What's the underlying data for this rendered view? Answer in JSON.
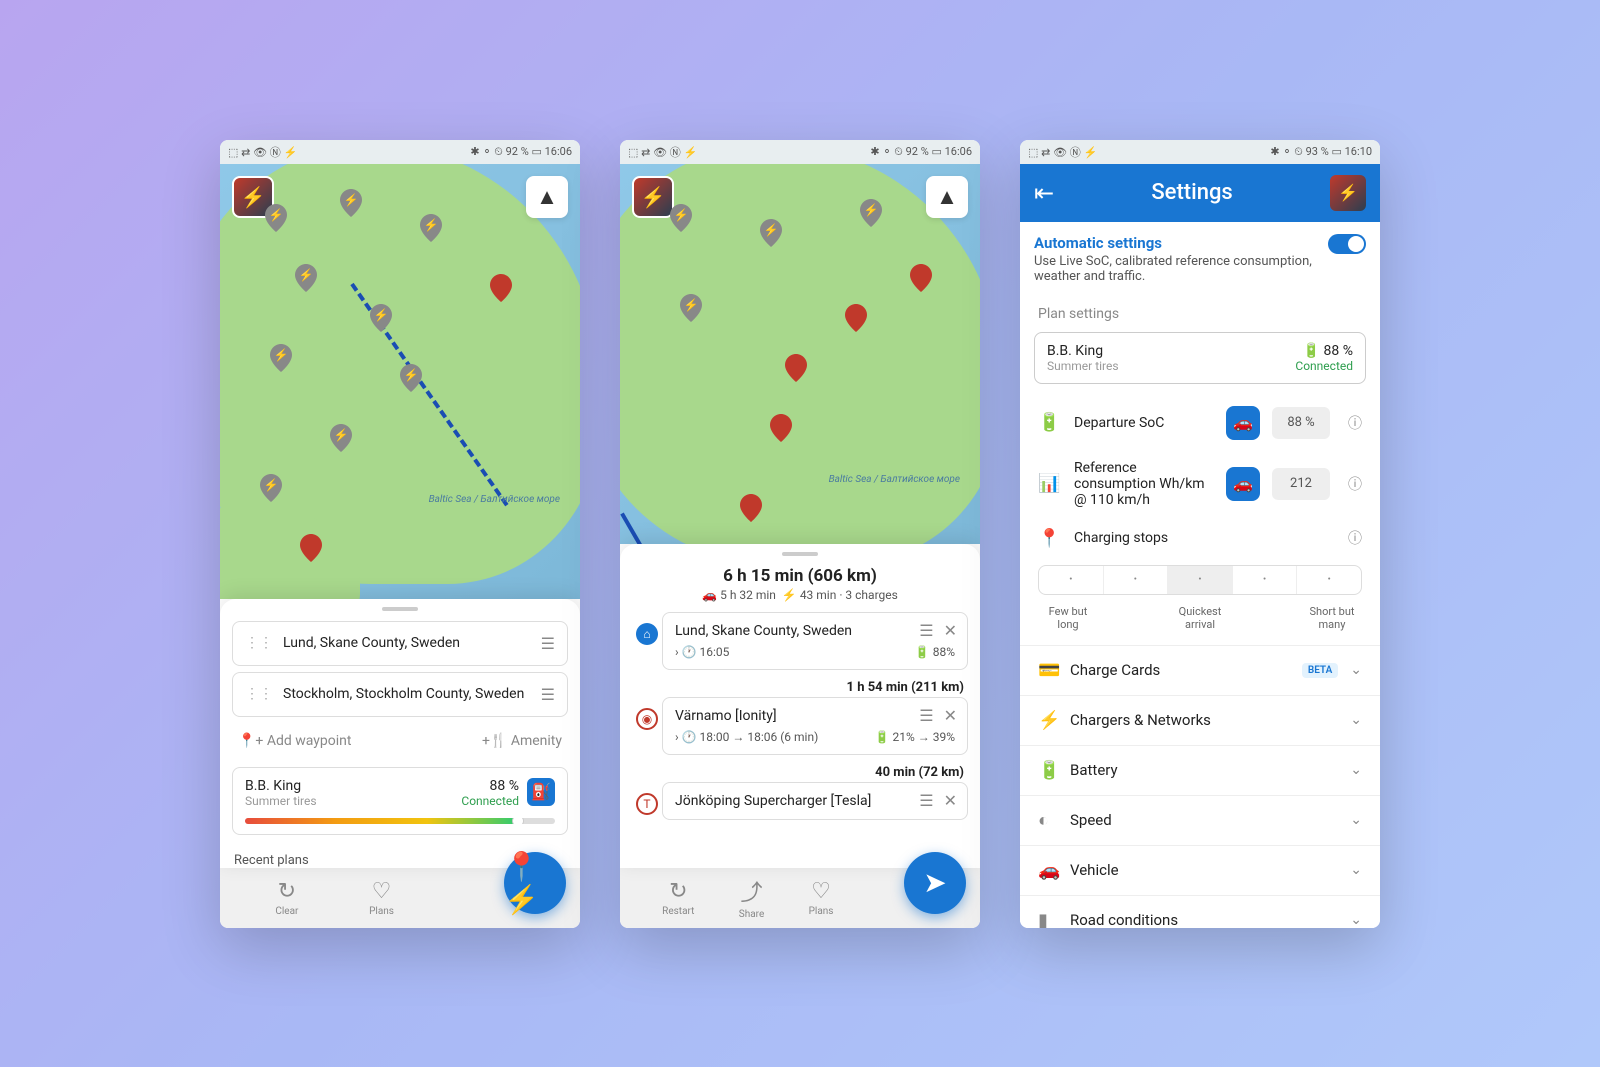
{
  "status_bar": {
    "left_icons": "⬚ ⇄ 👁 Ⓝ ⚡",
    "right1": "✱ ⚬ ⏲ 92 % ▭ 16:06",
    "right3": "✱ ⚬ ⏲ 93 % ▭ 16:10"
  },
  "screen1": {
    "sea_label": "Baltic Sea\n/ Балтийское\nморе",
    "origin": "Lund, Skane County, Sweden",
    "destination": "Stockholm, Stockholm County, Sweden",
    "add_waypoint": "Add waypoint",
    "amenity": "Amenity",
    "vehicle": {
      "name": "B.B. King",
      "tires": "Summer tires",
      "pct": "88 %",
      "status": "Connected"
    },
    "recent_plans": "Recent plans",
    "nav": {
      "clear": "Clear",
      "plans": "Plans"
    }
  },
  "screen2": {
    "sea_label": "Baltic Sea\n/ Балтийское\nморе",
    "summary": {
      "title": "6 h 15 min (606 km)",
      "drive": "5 h 32 min",
      "charge": "43 min · 3 charges"
    },
    "stops": [
      {
        "name": "Lund, Skane County, Sweden",
        "depart": "16:05",
        "pct": "88%"
      },
      {
        "seg": "1 h 54 min (211 km)"
      },
      {
        "name": "Värnamo [Ionity]",
        "time": "18:00 → 18:06 (6 min)",
        "pct": "21% → 39%"
      },
      {
        "seg": "40 min (72 km)"
      },
      {
        "name": "Jönköping Supercharger [Tesla]"
      }
    ],
    "nav": {
      "restart": "Restart",
      "share": "Share",
      "plans": "Plans"
    }
  },
  "screen3": {
    "title": "Settings",
    "auto": {
      "title": "Automatic settings",
      "desc": "Use Live SoC, calibrated reference consumption, weather and traffic."
    },
    "plan_settings_label": "Plan settings",
    "vehicle": {
      "name": "B.B. King",
      "tires": "Summer tires",
      "pct": "88 %",
      "status": "Connected"
    },
    "departure_soc": {
      "label": "Departure SoC",
      "value": "88 %"
    },
    "ref_cons": {
      "label": "Reference consumption Wh/km @ 110 km/h",
      "value": "212"
    },
    "charging_stops": "Charging stops",
    "slider": {
      "left": "Few but long",
      "mid": "Quickest arrival",
      "right": "Short but many"
    },
    "rows": {
      "charge_cards": "Charge Cards",
      "beta": "BETA",
      "chargers": "Chargers & Networks",
      "battery": "Battery",
      "speed": "Speed",
      "vehicle": "Vehicle",
      "road": "Road conditions"
    }
  }
}
